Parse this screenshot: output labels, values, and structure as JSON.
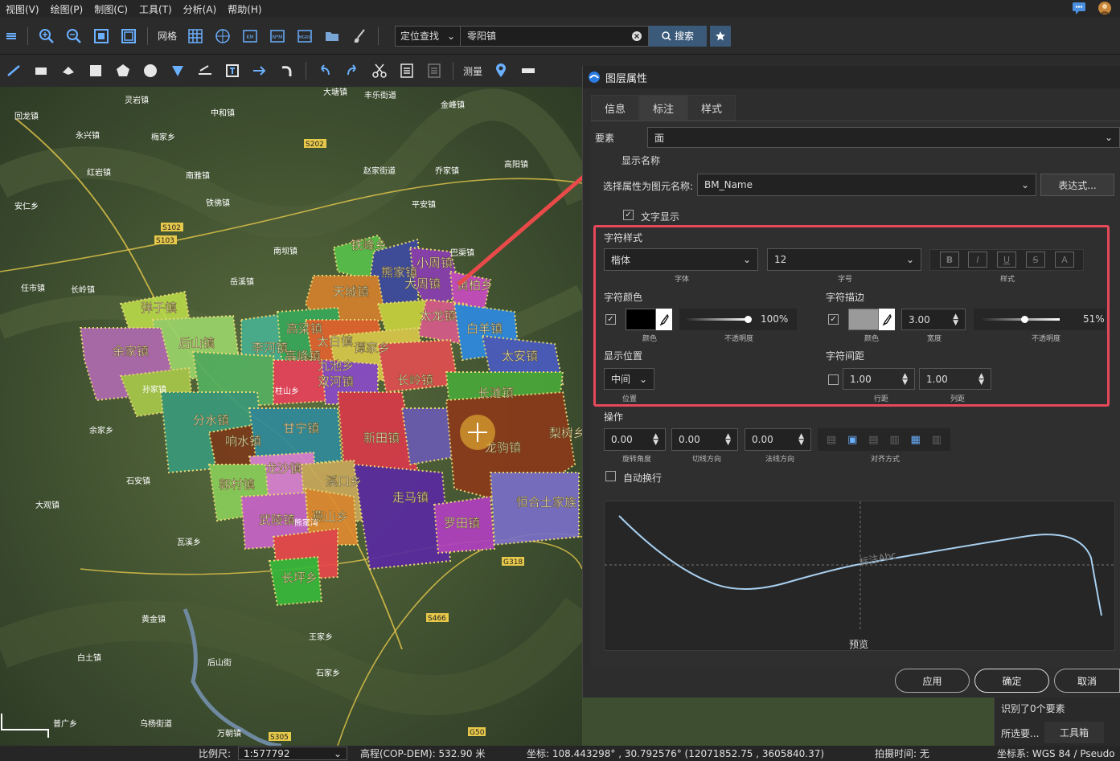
{
  "menu": {
    "items": [
      "视图(V)",
      "绘图(P)",
      "制图(C)",
      "工具(T)",
      "分析(A)",
      "帮助(H)"
    ]
  },
  "toolbar": {
    "grid_label": "网格",
    "locate_label": "定位查找",
    "search_value": "零阳镇",
    "search_button": "搜索",
    "measure_label": "测量"
  },
  "map": {
    "places": [
      "灵岩镇",
      "中和镇",
      "大塘镇",
      "丰乐街道",
      "金峰镇",
      "回龙镇",
      "永兴镇",
      "梅家乡",
      "红岩镇",
      "乔家镇",
      "高阳镇",
      "安仁乡",
      "南雅镇",
      "铁佛镇",
      "赵家街道",
      "平安镇",
      "任市镇",
      "长岭镇",
      "岳溪镇",
      "南坝镇",
      "巴渠镇",
      "铁峰乡",
      "熊家镇",
      "小周镇",
      "大周镇",
      "黄柏乡",
      "天城镇",
      "太龙镇",
      "白羊镇",
      "弹子镇",
      "后山镇",
      "余家镇",
      "李河镇",
      "高梁镇",
      "孙家镇",
      "高峰镇",
      "太安镇",
      "分水镇",
      "甘宁镇",
      "新田镇",
      "长滩镇",
      "响水镇",
      "龙驹镇",
      "龙沙镇",
      "郭村镇",
      "熊家湾",
      "走马镇",
      "梨树乡",
      "武陵镇",
      "燕山乡",
      "罗田镇",
      "恒合土家族",
      "长坪乡",
      "大观镇",
      "柱山乡",
      "白土镇",
      "黄金镇",
      "石安镇",
      "后山街",
      "王家乡",
      "石家乡",
      "普广乡",
      "乌杨街道",
      "万朝镇",
      "瓦溪乡",
      "太白镇",
      "双河镇",
      "长岭镇",
      "余家乡",
      "九池乡",
      "溪口乡",
      "谭家乡"
    ],
    "roads": [
      "S102",
      "S202",
      "S103",
      "S466",
      "G318",
      "G50",
      "S305"
    ]
  },
  "dialog": {
    "title": "图层属性",
    "tabs": [
      "信息",
      "标注",
      "样式"
    ],
    "element_label": "要素",
    "element_value": "面",
    "display_name_label": "显示名称",
    "attr_label": "选择属性为图元名称:",
    "attr_value": "BM_Name",
    "expr_button": "表达式...",
    "text_display_label": "文字显示",
    "char_style_label": "字符样式",
    "font_value": "楷体",
    "font_caption": "字体",
    "size_value": "12",
    "size_caption": "字号",
    "style_caption": "样式",
    "char_color_label": "字符颜色",
    "color_caption": "颜色",
    "opacity_value": "100%",
    "opacity_caption": "不透明度",
    "outline_label": "字符描边",
    "outline_width": "3.00",
    "width_caption": "宽度",
    "outline_opacity": "51%",
    "outline_opacity_caption": "不透明度",
    "outline_color_caption": "颜色",
    "position_label": "显示位置",
    "position_value": "中间",
    "position_caption": "位置",
    "spacing_label": "字符间距",
    "line_spacing": "1.00",
    "line_spacing_caption": "行距",
    "col_spacing": "1.00",
    "col_spacing_caption": "列距",
    "ops_label": "操作",
    "rotation": "0.00",
    "rotation_caption": "旋转角度",
    "tangent": "0.00",
    "tangent_caption": "切线方向",
    "normal": "0.00",
    "normal_caption": "法线方向",
    "align_caption": "对齐方式",
    "wrap_label": "自动换行",
    "preview_text": "标注Abc",
    "preview_caption": "预览",
    "apply_button": "应用",
    "ok_button": "确定",
    "cancel_button": "取消"
  },
  "context_panel": {
    "recognized": "识别了0个要素",
    "select": "所选要...",
    "toolbox": "工具箱"
  },
  "status": {
    "scale_label": "比例尺:",
    "scale_value": "1:577792",
    "elevation": "高程(COP-DEM): 532.90 米",
    "coords": "坐标: 108.443298° , 30.792576°  (12071852.75 , 3605840.37)",
    "capture_time": "拍摄时间: 无",
    "crs": "坐标系: WGS 84 / Pseudo"
  },
  "colors": {
    "accent": "#3b5a7a",
    "highlight": "#e8485a"
  }
}
